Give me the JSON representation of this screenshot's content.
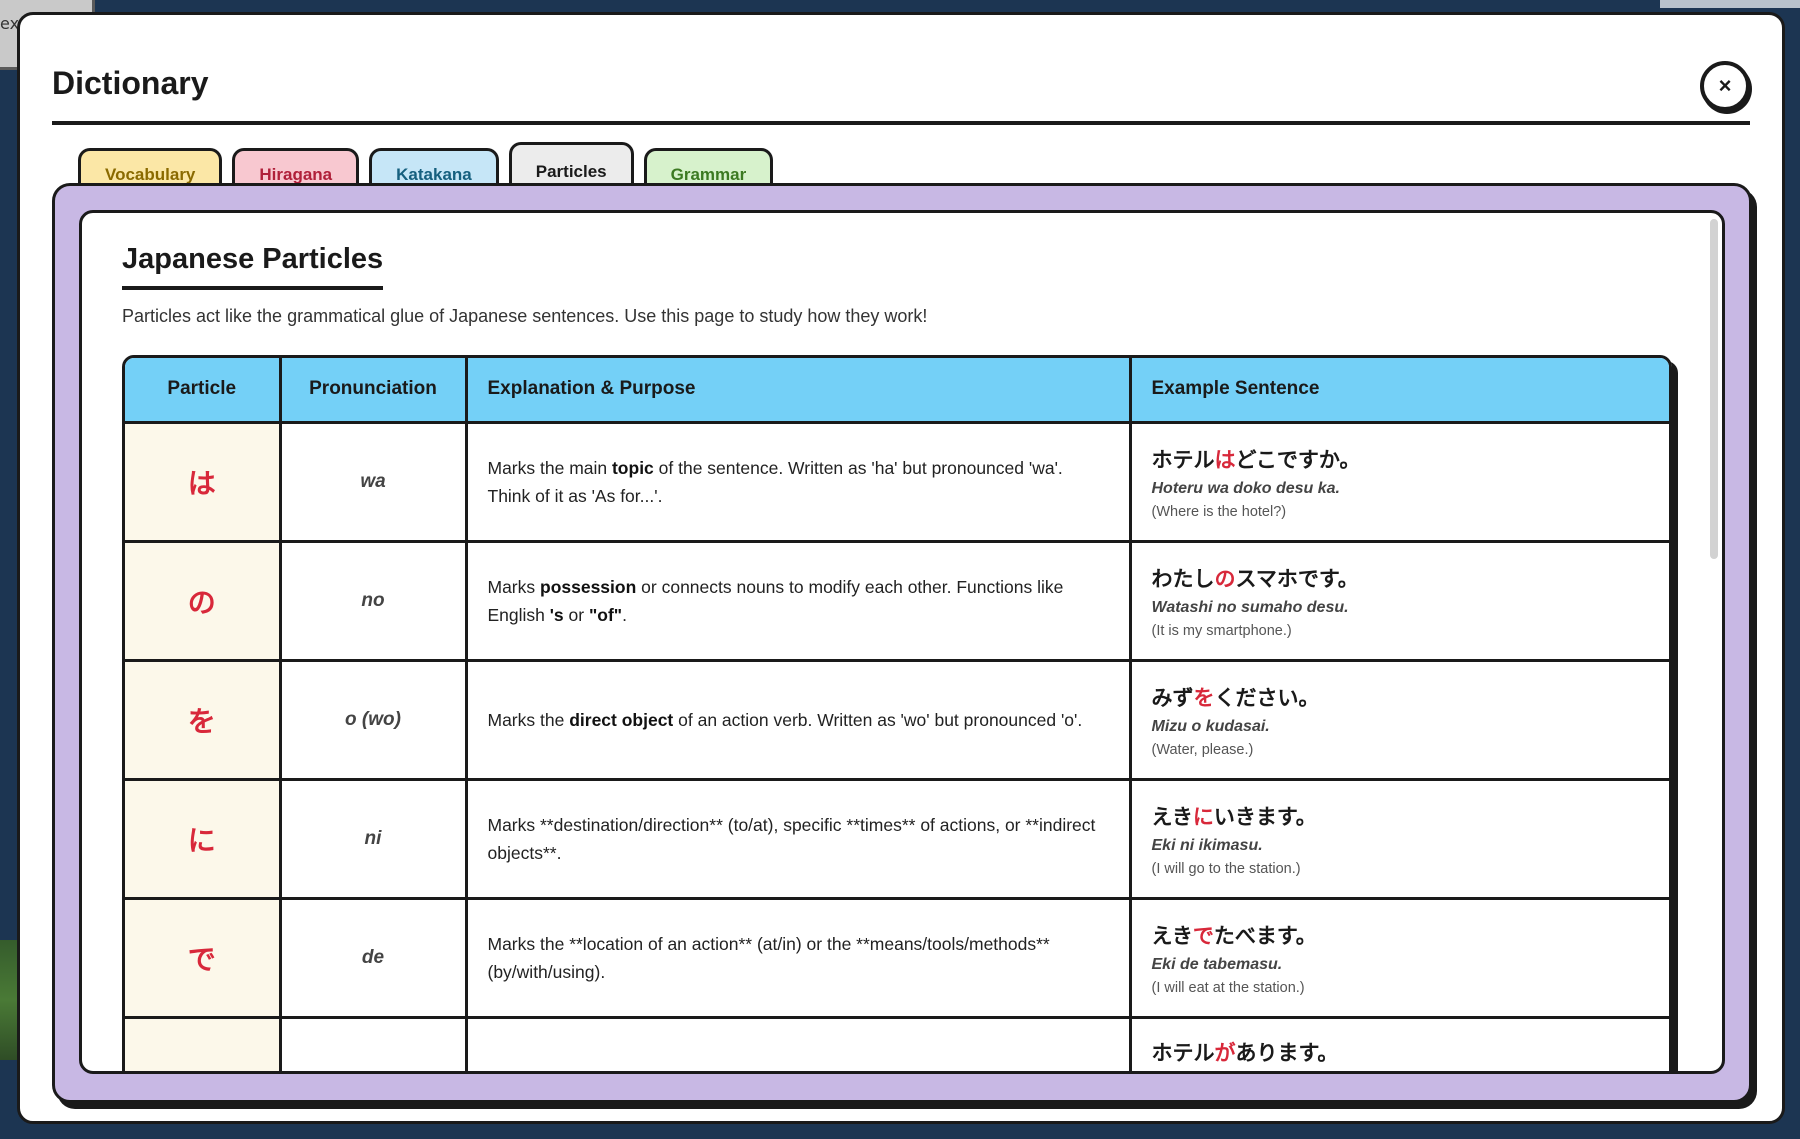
{
  "background": {
    "fragment_text": "ex"
  },
  "modal": {
    "title": "Dictionary",
    "close_icon": "×"
  },
  "tabs": [
    {
      "label": "Vocabulary"
    },
    {
      "label": "Hiragana"
    },
    {
      "label": "Katakana"
    },
    {
      "label": "Particles",
      "active": true
    },
    {
      "label": "Grammar"
    }
  ],
  "section": {
    "title": "Japanese Particles",
    "description": "Particles act like the grammatical glue of Japanese sentences. Use this page to study how they work!"
  },
  "table": {
    "headers": [
      "Particle",
      "Pronunciation",
      "Explanation & Purpose",
      "Example Sentence"
    ],
    "rows": [
      {
        "particle": "は",
        "pron": "wa",
        "expl": [
          "Marks the main ",
          "topic",
          " of the sentence. Written as 'ha' but pronounced 'wa'. Think of it as 'As for...'."
        ],
        "jp": [
          "ホテル",
          "は",
          "どこですか。"
        ],
        "romaji": "Hoteru wa doko desu ka.",
        "english": "(Where is the hotel?)"
      },
      {
        "particle": "の",
        "pron": "no",
        "expl": [
          "Marks ",
          "possession",
          " or connects nouns to modify each other. Functions like English ",
          "'s",
          " or ",
          "\"of\"",
          "."
        ],
        "jp": [
          "わたし",
          "の",
          "スマホです。"
        ],
        "romaji": "Watashi no sumaho desu.",
        "english": "(It is my smartphone.)"
      },
      {
        "particle": "を",
        "pron": "o (wo)",
        "expl": [
          "Marks the ",
          "direct object",
          " of an action verb. Written as 'wo' but pronounced 'o'."
        ],
        "jp": [
          "みず",
          "を",
          "ください。"
        ],
        "romaji": "Mizu o kudasai.",
        "english": "(Water, please.)"
      },
      {
        "particle": "に",
        "pron": "ni",
        "expl": [
          "Marks **destination/direction** (to/at), specific **times** of actions, or **indirect objects**."
        ],
        "jp": [
          "えき",
          "に",
          "いきます。"
        ],
        "romaji": "Eki ni ikimasu.",
        "english": "(I will go to the station.)"
      },
      {
        "particle": "で",
        "pron": "de",
        "expl": [
          "Marks the **location of an action** (at/in) or the **means/tools/methods** (by/with/using)."
        ],
        "jp": [
          "えき",
          "で",
          "たべます。"
        ],
        "romaji": "Eki de tabemasu.",
        "english": "(I will eat at the station.)"
      },
      {
        "particle": "",
        "pron": "",
        "expl": [
          ""
        ],
        "jp": [
          "ホテル",
          "が",
          "あります。"
        ],
        "romaji": "",
        "english": ""
      }
    ]
  }
}
